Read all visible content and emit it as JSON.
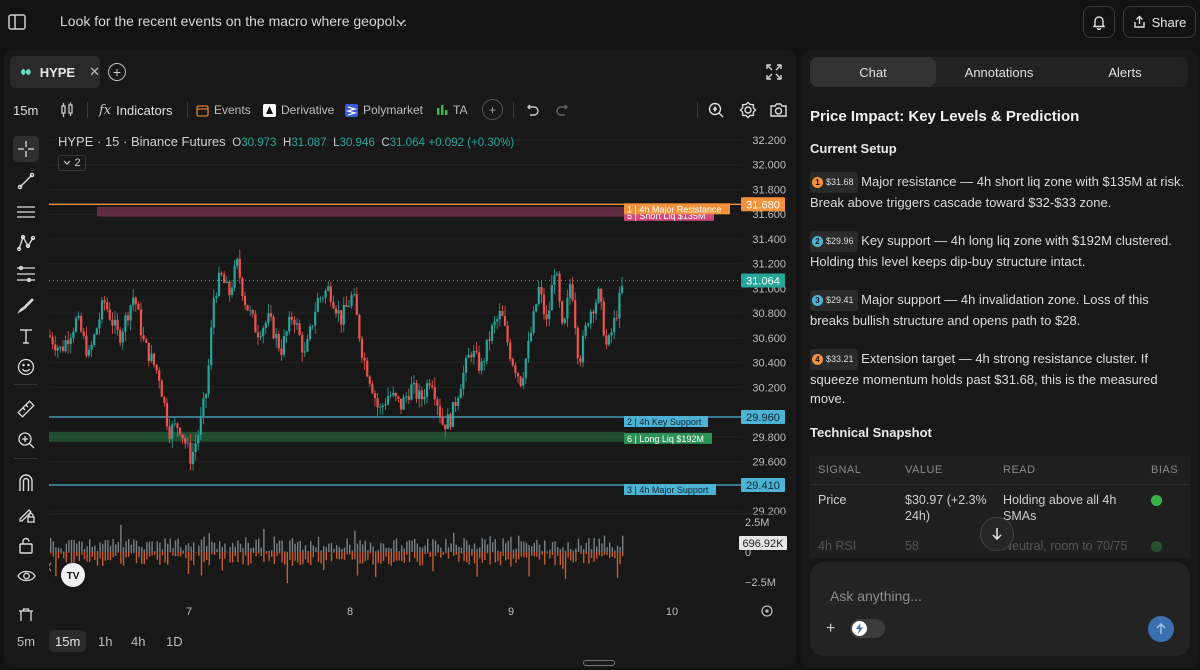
{
  "header": {
    "title": "Look for the recent events on the macro where geopol...",
    "share_label": "Share"
  },
  "chart_panel": {
    "symbol_tab": "HYPE",
    "toolbar": {
      "interval": "15m",
      "indicators": "Indicators",
      "events": "Events",
      "derivative": "Derivative",
      "polymarket": "Polymarket",
      "ta": "TA"
    },
    "legend": {
      "title": "HYPE · 15 · Binance Futures",
      "o_label": "O",
      "o": "30.973",
      "h_label": "H",
      "h": "31.087",
      "l_label": "L",
      "l": "30.946",
      "c_label": "C",
      "c": "31.064",
      "change": "+0.092 (+0.30%)"
    },
    "indicator_count": "2",
    "timeframes": [
      "5m",
      "15m",
      "1h",
      "4h",
      "1D"
    ],
    "active_timeframe": "15m",
    "watermark": "TV"
  },
  "chart_data": {
    "type": "candlestick",
    "ylim": [
      29.2,
      32.2
    ],
    "y_ticks": [
      "32.200",
      "32.000",
      "31.800",
      "31.600",
      "31.400",
      "31.200",
      "31.000",
      "30.800",
      "30.600",
      "30.400",
      "30.200",
      "29.800",
      "29.600",
      "29.200"
    ],
    "x_ticks": [
      "7",
      "8",
      "9",
      "10"
    ],
    "last_price": "31.064",
    "levels": [
      {
        "price": "31.680",
        "label": "1 | 4h Major Resistance",
        "color": "#f5913a"
      },
      {
        "price": "29.960",
        "label": "2 | 4h Key Support",
        "color": "#4cb3d4"
      },
      {
        "price": "29.410",
        "label": "3 | 4h Major Support",
        "color": "#4cb3d4"
      }
    ],
    "zones": [
      {
        "label": "5 | Short Liq $135M",
        "from": 31.58,
        "to": 31.66,
        "color": "#e4508a"
      },
      {
        "label": "6 | Long Liq $192M",
        "from": 29.76,
        "to": 29.84,
        "color": "#2e9e5b"
      }
    ],
    "volume": {
      "ticks": [
        "2.5M",
        "0",
        "−2.5M"
      ],
      "last": "696.92K"
    }
  },
  "side": {
    "tabs": [
      "Chat",
      "Annotations",
      "Alerts"
    ],
    "active_tab": "Chat",
    "heading": "Price Impact: Key Levels & Prediction",
    "current_setup": "Current Setup",
    "items": [
      {
        "n": "1",
        "color": "#f5913a",
        "price": "$31.68",
        "text": "Major resistance — 4h short liq zone with $135M at risk. Break above triggers cascade toward $32-$33 zone."
      },
      {
        "n": "2",
        "color": "#4cb3d4",
        "price": "$29.96",
        "text": "Key support — 4h long liq zone with $192M clustered. Holding this level keeps dip-buy structure intact."
      },
      {
        "n": "3",
        "color": "#4cb3d4",
        "price": "$29.41",
        "text": "Major support — 4h invalidation zone. Loss of this breaks bullish structure and opens path to $28."
      },
      {
        "n": "4",
        "color": "#f5913a",
        "price": "$33.21",
        "text": "Extension target — 4h strong resistance cluster. If squeeze momentum holds past $31.68, this is the measured move."
      }
    ],
    "snapshot_title": "Technical Snapshot",
    "table": {
      "headers": [
        "SIGNAL",
        "VALUE",
        "READ",
        "BIAS"
      ],
      "rows": [
        {
          "signal": "Price",
          "value": "$30.97 (+2.3% 24h)",
          "read": "Holding above all 4h SMAs"
        },
        {
          "signal": "4h RSI",
          "value": "58",
          "read": "Neutral, room to 70/75"
        }
      ]
    },
    "ask_placeholder": "Ask anything..."
  }
}
